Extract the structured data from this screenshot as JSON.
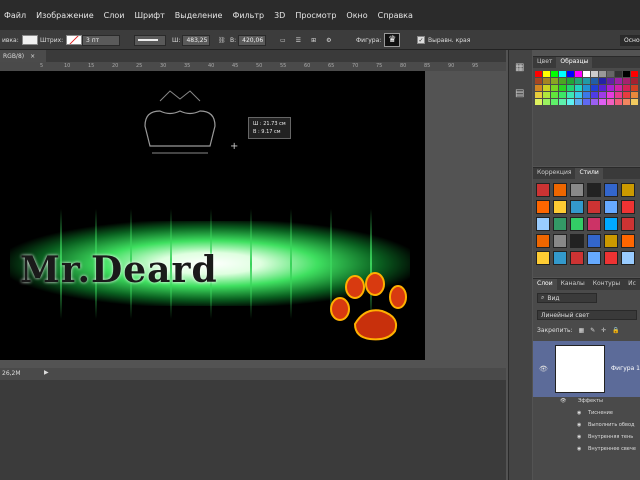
{
  "menu": [
    "Файл",
    "Изображение",
    "Слои",
    "Шрифт",
    "Выделение",
    "Фильтр",
    "3D",
    "Просмотр",
    "Окно",
    "Справка"
  ],
  "options": {
    "fill_label": "ивка:",
    "stroke_label": "Штрих:",
    "stroke_width": "3 пт",
    "w_label": "Ш:",
    "w_value": "483,25",
    "h_label": "В:",
    "h_value": "420,06",
    "shape_label": "Фигура:",
    "align_label": "Выравн. края",
    "right_button": "Осно"
  },
  "document": {
    "tab_label": "RGB/8)",
    "title_text": "Mr.Deard",
    "tooltip_w": "Ш :  21.73 см",
    "tooltip_h": "В :   9.17 см",
    "zoom_status": "26,2М"
  },
  "ruler_ticks": [
    "5",
    "10",
    "15",
    "20",
    "25",
    "30",
    "35",
    "40",
    "45",
    "50",
    "55",
    "60",
    "65",
    "70",
    "75",
    "80",
    "85",
    "90",
    "95"
  ],
  "swatches_panel": {
    "tabs": [
      "Цвет",
      "Образцы"
    ]
  },
  "styles_panel": {
    "tabs": [
      "Коррекция",
      "Стили"
    ]
  },
  "layers_panel": {
    "tabs": [
      "Слои",
      "Каналы",
      "Контуры",
      "Ис"
    ],
    "filter": "Вид",
    "blend_mode": "Линейный свет",
    "lock_label": "Закрепить:",
    "layer_name": "Фигура 1",
    "effects_label": "Эффекты",
    "effects": [
      "Тиснение",
      "Выполнить обвод",
      "Внутренняя тень",
      "Внутреннее свече"
    ]
  },
  "colors": {
    "accent_selected": "#5c6b99",
    "glow": "#3fe060"
  }
}
